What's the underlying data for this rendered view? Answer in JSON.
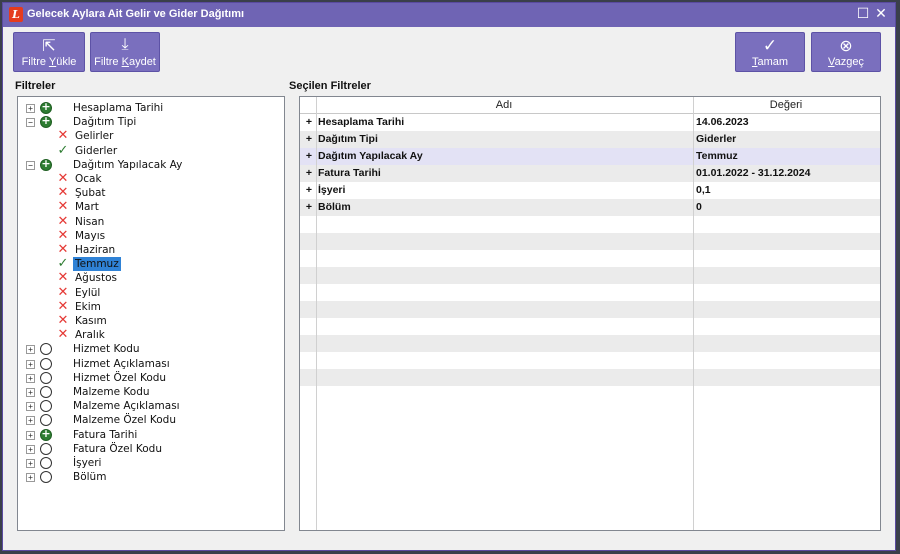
{
  "window": {
    "title": "Gelecek Aylara Ait Gelir ve Gider Dağıtımı",
    "app_icon": "L",
    "maximize_glyph": "☐",
    "close_glyph": "✕"
  },
  "toolbar": {
    "load_filter": {
      "icon": "folder-out-icon",
      "glyph": "⇱",
      "label_pre": "Filtre ",
      "label_ul": "Y",
      "label_post": "ükle"
    },
    "save_filter": {
      "icon": "download-icon",
      "glyph": "⤓",
      "label_pre": "Filtre ",
      "label_ul": "K",
      "label_post": "aydet"
    },
    "ok": {
      "icon": "check-icon",
      "glyph": "✓",
      "label_pre": "",
      "label_ul": "T",
      "label_post": "amam"
    },
    "cancel": {
      "icon": "cancel-circle-icon",
      "glyph": "⊗",
      "label_pre": "",
      "label_ul": "V",
      "label_post": "azgeç"
    }
  },
  "left_panel": {
    "label": "Filtreler"
  },
  "right_panel": {
    "label": "Seçilen Filtreler"
  },
  "tree": [
    {
      "label": "Hesaplama Tarihi",
      "level": 0,
      "expander": "+",
      "state": "on"
    },
    {
      "label": "Dağıtım Tipi",
      "level": 0,
      "expander": "−",
      "state": "on"
    },
    {
      "label": "Gelirler",
      "level": 1,
      "state": "x"
    },
    {
      "label": "Giderler",
      "level": 1,
      "state": "ok"
    },
    {
      "label": "Dağıtım Yapılacak  Ay",
      "level": 0,
      "expander": "−",
      "state": "on"
    },
    {
      "label": "Ocak",
      "level": 1,
      "state": "x"
    },
    {
      "label": "Şubat",
      "level": 1,
      "state": "x"
    },
    {
      "label": "Mart",
      "level": 1,
      "state": "x"
    },
    {
      "label": "Nisan",
      "level": 1,
      "state": "x"
    },
    {
      "label": "Mayıs",
      "level": 1,
      "state": "x"
    },
    {
      "label": "Haziran",
      "level": 1,
      "state": "x"
    },
    {
      "label": "Temmuz",
      "level": 1,
      "state": "ok",
      "selected": true
    },
    {
      "label": "Ağustos",
      "level": 1,
      "state": "x"
    },
    {
      "label": "Eylül",
      "level": 1,
      "state": "x"
    },
    {
      "label": "Ekim",
      "level": 1,
      "state": "x"
    },
    {
      "label": "Kasım",
      "level": 1,
      "state": "x"
    },
    {
      "label": "Aralık",
      "level": 1,
      "state": "x"
    },
    {
      "label": "Hizmet Kodu",
      "level": 0,
      "expander": "+",
      "state": "off"
    },
    {
      "label": "Hizmet Açıklaması",
      "level": 0,
      "expander": "+",
      "state": "off"
    },
    {
      "label": "Hizmet Özel Kodu",
      "level": 0,
      "expander": "+",
      "state": "off"
    },
    {
      "label": "Malzeme Kodu",
      "level": 0,
      "expander": "+",
      "state": "off"
    },
    {
      "label": "Malzeme Açıklaması",
      "level": 0,
      "expander": "+",
      "state": "off"
    },
    {
      "label": "Malzeme Özel Kodu",
      "level": 0,
      "expander": "+",
      "state": "off"
    },
    {
      "label": "Fatura Tarihi",
      "level": 0,
      "expander": "+",
      "state": "on"
    },
    {
      "label": "Fatura Özel Kodu",
      "level": 0,
      "expander": "+",
      "state": "off"
    },
    {
      "label": "İşyeri",
      "level": 0,
      "expander": "+",
      "state": "off"
    },
    {
      "label": "Bölüm",
      "level": 0,
      "expander": "+",
      "state": "off"
    }
  ],
  "grid": {
    "columns": [
      "Adı",
      "Değeri"
    ],
    "rows": [
      {
        "name": "Hesaplama Tarihi",
        "value": "14.06.2023"
      },
      {
        "name": "Dağıtım Tipi",
        "value": "Giderler"
      },
      {
        "name": "Dağıtım Yapılacak  Ay",
        "value": "Temmuz",
        "highlight": true
      },
      {
        "name": "Fatura Tarihi",
        "value": "01.01.2022 - 31.12.2024"
      },
      {
        "name": "İşyeri",
        "value": "0,1"
      },
      {
        "name": "Bölüm",
        "value": "0"
      }
    ],
    "plus_glyph": "+",
    "empty_rows": 10,
    "colors": {
      "alt_row": "#ebebeb",
      "highlight_row": "#e3e2f5"
    }
  },
  "colors": {
    "titlebar": "#6f64b4",
    "button": "#7a6fbe",
    "selection": "#2f82d6",
    "x_mark": "#e53935",
    "check_mark": "#2e7d32"
  }
}
